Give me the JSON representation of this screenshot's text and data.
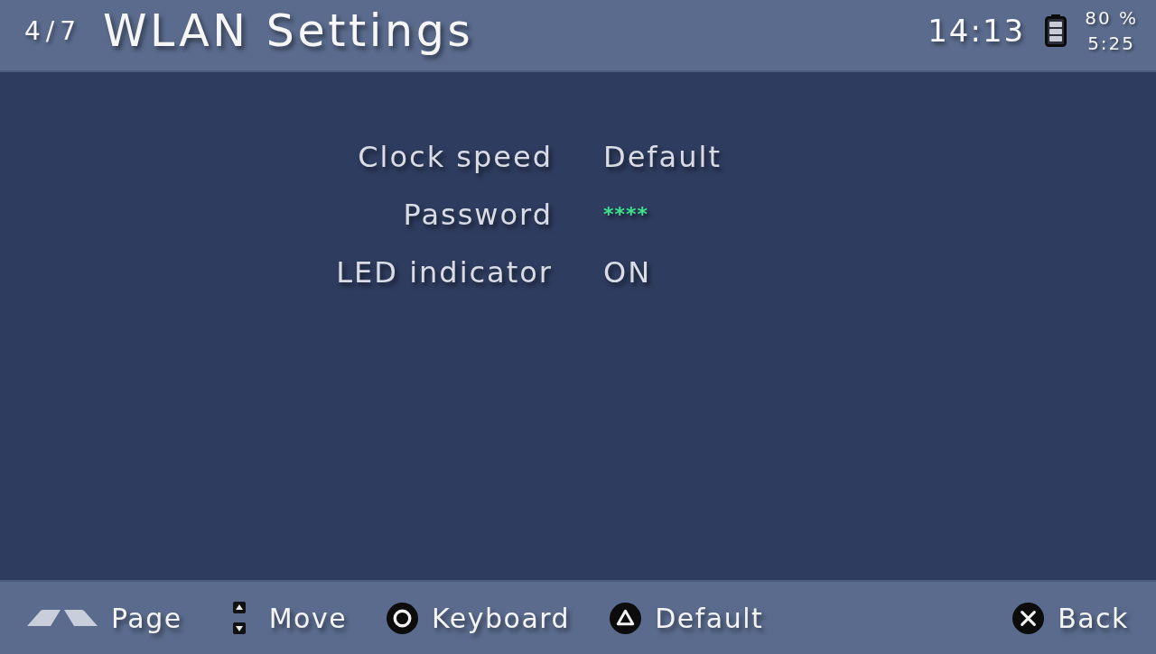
{
  "header": {
    "page": "4/7",
    "title": "WLAN Settings",
    "clock": "14:13",
    "battery_percent": "80 %",
    "battery_time": "5:25"
  },
  "settings": [
    {
      "label": "Clock speed",
      "value": "Default",
      "kind": "text"
    },
    {
      "label": "Password",
      "value": "****",
      "kind": "masked"
    },
    {
      "label": "LED indicator",
      "value": "ON",
      "kind": "text"
    }
  ],
  "hints": [
    {
      "kind": "shoulder",
      "label": "Page"
    },
    {
      "kind": "updown",
      "label": "Move"
    },
    {
      "kind": "circle",
      "label": "Keyboard"
    },
    {
      "kind": "triangle",
      "label": "Default"
    },
    {
      "kind": "cross",
      "label": "Back"
    }
  ]
}
